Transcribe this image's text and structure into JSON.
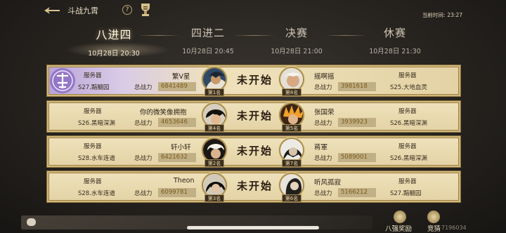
{
  "header": {
    "title": "斗战九霄",
    "help_glyph": "?",
    "time_label": "当前时间:",
    "time_value": "23:27"
  },
  "tabs": [
    {
      "label": "八进四",
      "time": "10月28日 20:30",
      "active": true
    },
    {
      "label": "四进二",
      "time": "10月28日 20:45",
      "active": false
    },
    {
      "label": "决赛",
      "time": "10月28日 21:00",
      "active": false
    },
    {
      "label": "休赛",
      "time": "10月28日 21:30",
      "active": false
    }
  ],
  "matches": [
    {
      "status": "未开始",
      "highlight": true,
      "left": {
        "server_label": "服务器",
        "server": "S27.黯髓园",
        "name": "繁V星",
        "power_label": "总战力",
        "power": "6841489",
        "rank": "第1名"
      },
      "right": {
        "server_label": "服务器",
        "server": "S25.大地血灵",
        "name": "摇啊摇",
        "power_label": "总战力",
        "power": "3981618",
        "rank": "第8名"
      }
    },
    {
      "status": "未开始",
      "highlight": false,
      "left": {
        "server_label": "服务器",
        "server": "S26.黑暗深渊",
        "name": "你的微笑像拥抱",
        "power_label": "总战力",
        "power": "4653646",
        "rank": "第4名"
      },
      "right": {
        "server_label": "服务器",
        "server": "S26.黑暗深渊",
        "name": "张国荣",
        "power_label": "总战力",
        "power": "3939923",
        "rank": "第5名"
      }
    },
    {
      "status": "未开始",
      "highlight": false,
      "left": {
        "server_label": "服务器",
        "server": "S28.水车连道",
        "name": "轩小轩",
        "power_label": "总战力",
        "power": "6421632",
        "rank": "第2名"
      },
      "right": {
        "server_label": "服务器",
        "server": "S26.黑暗深渊",
        "name": "蒋軍",
        "power_label": "总战力",
        "power": "5089001",
        "rank": "第7名"
      }
    },
    {
      "status": "未开始",
      "highlight": false,
      "left": {
        "server_label": "服务器",
        "server": "S28.水车连道",
        "name": "Theon",
        "power_label": "总战力",
        "power": "6099781",
        "rank": "第3名"
      },
      "right": {
        "server_label": "服务器",
        "server": "S27.黯髓园",
        "name": "听风孤寂",
        "power_label": "总战力",
        "power": "5166212",
        "rank": "第6名"
      }
    }
  ],
  "footer": {
    "reward_eight": "八强奖励",
    "reward_other": "竞猜",
    "uid": "7196034"
  },
  "colors": {
    "accent_gold": "#a98b4b",
    "power_text": "#7a5c1c",
    "row_bg": "#e3d2a4",
    "highlight_purple": "#b8a3d9"
  }
}
